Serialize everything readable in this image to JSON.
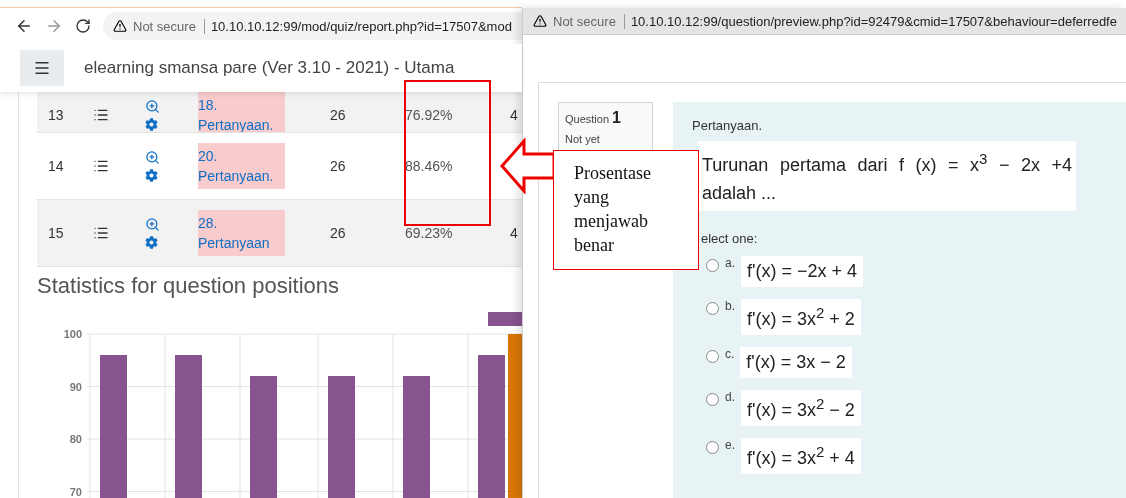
{
  "left_window": {
    "address_bar": {
      "security": "Not secure",
      "url": "10.10.10.12:99/mod/quiz/report.php?id=17507&mod"
    },
    "site_title": "elearning smansa pare (Ver 3.10 - 2021) - Utama",
    "table": {
      "rows": [
        {
          "number": "13",
          "question": "18. Pertanyaan.",
          "attempts": "26",
          "percent": "76.92%",
          "column_7": "4"
        },
        {
          "number": "14",
          "question": "20. Pertanyaan.",
          "attempts": "26",
          "percent": "88.46%"
        },
        {
          "number": "15",
          "question": "28. Pertanyaan",
          "attempts": "26",
          "percent": "69.23%",
          "column_7": "4"
        }
      ]
    },
    "stats_title": "Statistics for question positions",
    "chart_data": {
      "type": "bar",
      "grid": true,
      "ylim": [
        68,
        100
      ],
      "yticks": [
        70,
        80,
        90,
        100
      ],
      "series": [
        {
          "color": "#87548f",
          "values": [
            96,
            96,
            92,
            92,
            92,
            96
          ]
        },
        {
          "color": "#d97706",
          "values": [
            null,
            null,
            null,
            null,
            null,
            100
          ]
        }
      ]
    }
  },
  "right_window": {
    "address_bar": {
      "security": "Not secure",
      "url": "10.10.10.12:99/question/preview.php?id=92479&cmid=17507&behaviour=deferredfe"
    },
    "question_info": {
      "label": "Question",
      "number": "1",
      "state": "Not yet"
    },
    "question_name": "Pertanyaan.",
    "question_text": "Turunan pertama dari f (x) = x$^{3}$ − 2x +4 adalah ...",
    "prompt": "elect one:",
    "options": [
      {
        "letter": "a.",
        "answer": "f'(x) = −2x + 4",
        "selected": false
      },
      {
        "letter": "b.",
        "answer": "f'(x) = 3x$^{2}$ + 2",
        "selected": false
      },
      {
        "letter": "c.",
        "answer": "f'(x) = 3x − 2",
        "selected": false
      },
      {
        "letter": "d.",
        "answer": "f'(x) = 3x$^{2}$ − 2",
        "selected": false
      },
      {
        "letter": "e.",
        "answer": "f'(x) = 3x$^{2}$ + 4",
        "selected": false
      }
    ]
  },
  "annotations": {
    "callout": "Prosentase yang menjawab benar"
  }
}
